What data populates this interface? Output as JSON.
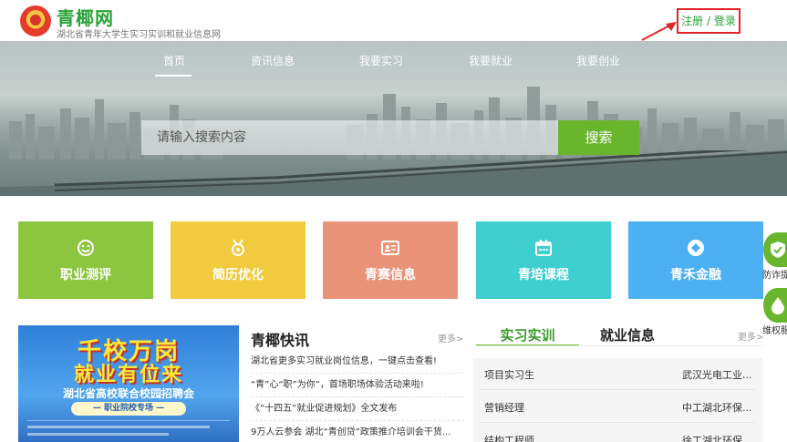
{
  "header": {
    "site_name": "青椰网",
    "site_subtitle": "湖北省青年大学生实习实训和就业信息网",
    "login_label": "注册 / 登录"
  },
  "nav": {
    "items": [
      {
        "label": "首页",
        "active": true
      },
      {
        "label": "资讯信息",
        "active": false
      },
      {
        "label": "我要实习",
        "active": false
      },
      {
        "label": "我要就业",
        "active": false
      },
      {
        "label": "我要创业",
        "active": false
      }
    ]
  },
  "search": {
    "placeholder": "请输入搜索内容",
    "button_label": "搜索"
  },
  "tiles": [
    {
      "label": "职业测评",
      "icon": "smiley-icon",
      "color": "#8cc641"
    },
    {
      "label": "简历优化",
      "icon": "medal-icon",
      "color": "#f1ca3e"
    },
    {
      "label": "青赛信息",
      "icon": "id-card-icon",
      "color": "#e99379"
    },
    {
      "label": "青培课程",
      "icon": "calendar-icon",
      "color": "#3fcfd0"
    },
    {
      "label": "青禾金融",
      "icon": "diamond-icon",
      "color": "#4cb0f2"
    }
  ],
  "float_buttons": [
    {
      "label": "防诈提",
      "icon": "shield-check-icon"
    },
    {
      "label": "维权服",
      "icon": "water-drop-icon"
    }
  ],
  "promo": {
    "line1": "千校万岗",
    "line2": "就业有位来",
    "line3": "湖北省高校联合校园招聘会",
    "tag": "— 职业院校专场 —"
  },
  "news": {
    "title": "青椰快讯",
    "more_label": "更多>",
    "items": [
      "湖北省更多实习就业岗位信息，一键点击查看!",
      "“青”心“职”为你”，首场职场体验活动来啦!",
      "《“十四五”就业促进规划》全文发布",
      "9万人云参会 湖北“青创贷”政策推介培训会干货..."
    ]
  },
  "jobs_panel": {
    "tab_active": "实习实训",
    "tab_other": "就业信息",
    "more_label": "更多>",
    "rows": [
      {
        "title": "项目实习生",
        "company": "武汉光电工业..."
      },
      {
        "title": "营销经理",
        "company": "中工湖北环保..."
      },
      {
        "title": "结构工程师",
        "company": "徐工湖北环保..."
      }
    ]
  },
  "colors": {
    "brand_green": "#2aa339",
    "accent_green": "#6ab52e",
    "annotation_red": "#e0262a"
  }
}
